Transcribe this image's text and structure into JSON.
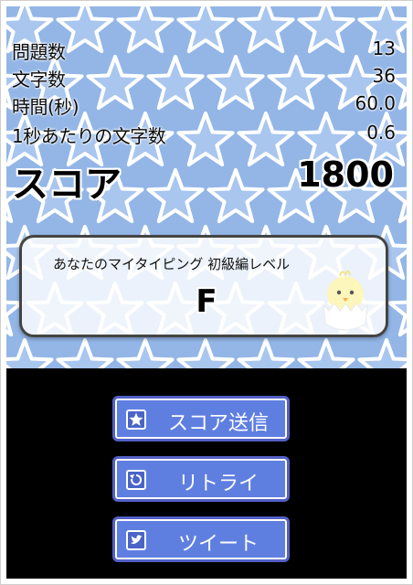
{
  "stats": [
    {
      "label": "問題数",
      "value": "13"
    },
    {
      "label": "文字数",
      "value": "36"
    },
    {
      "label": "時間(秒)",
      "value": "60.0"
    },
    {
      "label": "1秒あたりの文字数",
      "value": "0.6"
    }
  ],
  "score": {
    "label": "スコア",
    "value": "1800"
  },
  "rank": {
    "title": "あなたのマイタイピング 初級編レベル",
    "letter": "F"
  },
  "buttons": {
    "send_score": "スコア送信",
    "retry": "リトライ",
    "tweet": "ツイート"
  },
  "colors": {
    "background_blue": "#93b6e7",
    "button_blue": "#5f7fe0",
    "button_border": "#5360c4",
    "bottom_area": "#000000"
  },
  "icons": {
    "send_score": "star-icon",
    "retry": "retry-icon",
    "tweet": "bird-icon"
  }
}
